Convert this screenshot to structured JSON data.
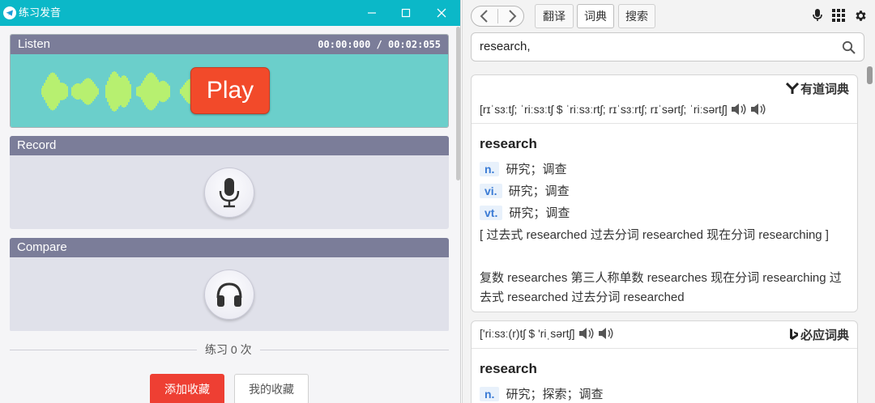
{
  "left_window": {
    "title": "练习发音",
    "listen": {
      "label": "Listen",
      "time": "00:00:000 / 00:02:055",
      "play_label": "Play"
    },
    "record": {
      "label": "Record"
    },
    "compare": {
      "label": "Compare"
    },
    "practice_count": "练习 0 次",
    "add_fav_label": "添加收藏",
    "my_fav_label": "我的收藏"
  },
  "right_window": {
    "tabs": {
      "translate": "翻译",
      "dictionary": "词典",
      "search": "搜索"
    },
    "search_value": "research,",
    "youdao": {
      "source_name": "有道词典",
      "phonetic": "[rɪˈsɜːtʃ; ˈriːsɜːtʃ $ ˈriːsɜːrtʃ; rɪˈsɜːrtʃ; rɪˈsərtʃ; ˈriːsərtʃ]",
      "word": "research",
      "definitions": [
        {
          "pos": "n.",
          "meaning": "研究；调查"
        },
        {
          "pos": "vi.",
          "meaning": "研究；调查"
        },
        {
          "pos": "vt.",
          "meaning": "研究；调查"
        }
      ],
      "forms_line_1": "[ 过去式 researched 过去分词 researched 现在分词 researching ]",
      "forms_line_2": "复数 researches 第三人称单数 researches 现在分词 researching 过去式 researched 过去分词 researched"
    },
    "bing": {
      "source_name": "必应词典",
      "phonetic": "['riːsɜː(r)tʃ $ 'riˌsərtʃ]",
      "word": "research",
      "definitions": [
        {
          "pos": "n.",
          "meaning": "研究；探索；调查"
        }
      ]
    }
  },
  "colors": {
    "titlebar": "#0bb8c8",
    "waveform": "#d8ff4a",
    "play": "#f24a2a",
    "panel_header": "#7b7d99",
    "add_fav": "#ee3f33"
  },
  "icons": [
    "telegram-icon",
    "minimize-icon",
    "maximize-icon",
    "close-icon",
    "microphone-icon",
    "headphones-icon",
    "chevron-left-icon",
    "chevron-right-icon",
    "mic-small-icon",
    "apps-grid-icon",
    "settings-gear-icon",
    "search-icon",
    "speaker-icon",
    "youdao-logo-icon",
    "bing-logo-icon"
  ]
}
